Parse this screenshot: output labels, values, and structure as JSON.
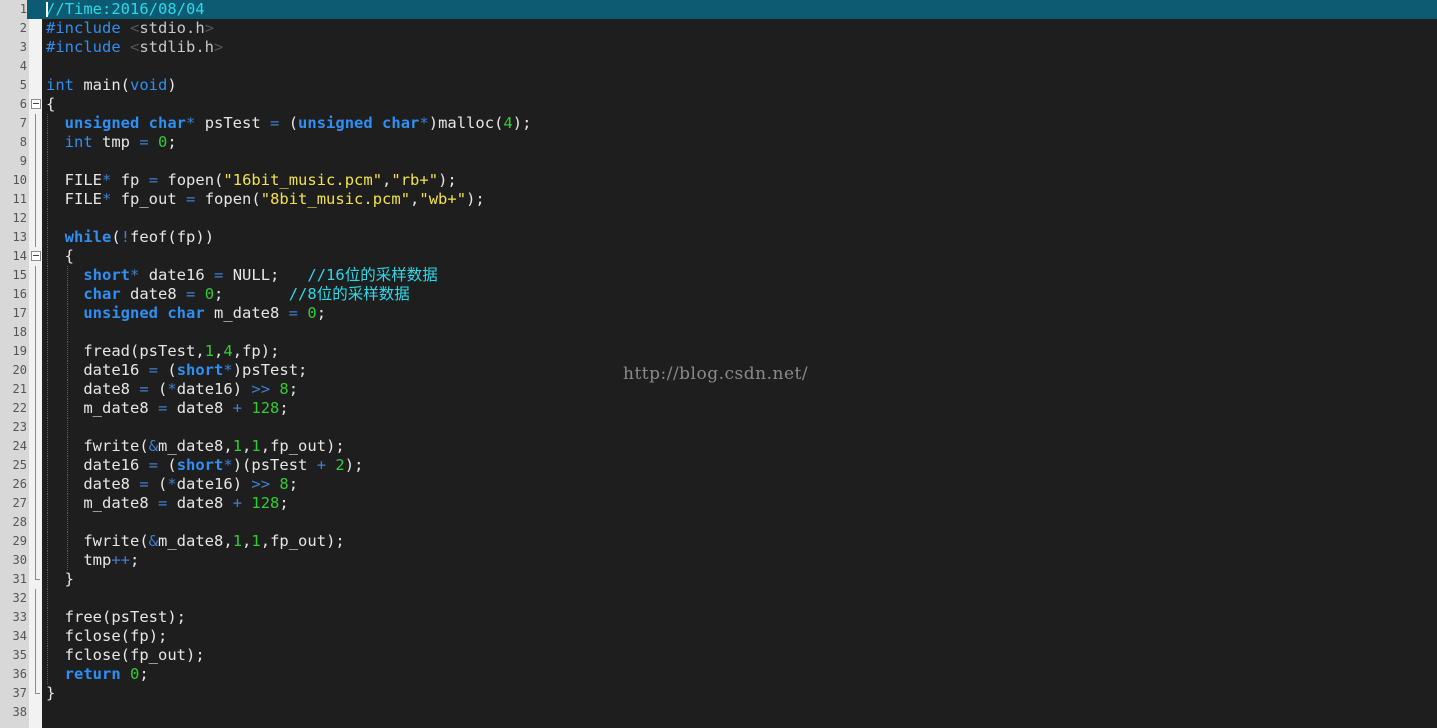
{
  "editor": {
    "language": "c",
    "current_line": 1,
    "colors": {
      "background": "#1e1e1e",
      "gutter": "#d8d8d8",
      "current_line": "#0d5a73",
      "keyword": "#2f8ff2",
      "number": "#33cc33",
      "string": "#f2e24a",
      "comment": "#2fd8e8"
    },
    "fold_icons": [
      "fold-minus-icon",
      "fold-line",
      "fold-end"
    ],
    "lines": [
      {
        "n": "1",
        "text": "//Time:2016/08/04"
      },
      {
        "n": "2",
        "text": "#include <stdio.h>"
      },
      {
        "n": "3",
        "text": "#include <stdlib.h>"
      },
      {
        "n": "4",
        "text": ""
      },
      {
        "n": "5",
        "text": "int main(void)"
      },
      {
        "n": "6",
        "text": "{"
      },
      {
        "n": "7",
        "text": "  unsigned char* psTest = (unsigned char*)malloc(4);"
      },
      {
        "n": "8",
        "text": "  int tmp = 0;"
      },
      {
        "n": "9",
        "text": ""
      },
      {
        "n": "10",
        "text": "  FILE* fp = fopen(\"16bit_music.pcm\",\"rb+\");"
      },
      {
        "n": "11",
        "text": "  FILE* fp_out = fopen(\"8bit_music.pcm\",\"wb+\");"
      },
      {
        "n": "12",
        "text": ""
      },
      {
        "n": "13",
        "text": "  while(!feof(fp))"
      },
      {
        "n": "14",
        "text": "  {"
      },
      {
        "n": "15",
        "text": "    short* date16 = NULL;   //16位的采样数据"
      },
      {
        "n": "16",
        "text": "    char date8 = 0;       //8位的采样数据"
      },
      {
        "n": "17",
        "text": "    unsigned char m_date8 = 0;"
      },
      {
        "n": "18",
        "text": ""
      },
      {
        "n": "19",
        "text": "    fread(psTest,1,4,fp);"
      },
      {
        "n": "20",
        "text": "    date16 = (short*)psTest;"
      },
      {
        "n": "21",
        "text": "    date8 = (*date16) >> 8;"
      },
      {
        "n": "22",
        "text": "    m_date8 = date8 + 128;"
      },
      {
        "n": "23",
        "text": ""
      },
      {
        "n": "24",
        "text": "    fwrite(&m_date8,1,1,fp_out);"
      },
      {
        "n": "25",
        "text": "    date16 = (short*)(psTest + 2);"
      },
      {
        "n": "26",
        "text": "    date8 = (*date16) >> 8;"
      },
      {
        "n": "27",
        "text": "    m_date8 = date8 + 128;"
      },
      {
        "n": "28",
        "text": ""
      },
      {
        "n": "29",
        "text": "    fwrite(&m_date8,1,1,fp_out);"
      },
      {
        "n": "30",
        "text": "    tmp++;"
      },
      {
        "n": "31",
        "text": "  }"
      },
      {
        "n": "32",
        "text": ""
      },
      {
        "n": "33",
        "text": "  free(psTest);"
      },
      {
        "n": "34",
        "text": "  fclose(fp);"
      },
      {
        "n": "35",
        "text": "  fclose(fp_out);"
      },
      {
        "n": "36",
        "text": "  return 0;"
      },
      {
        "n": "37",
        "text": "}"
      },
      {
        "n": "38",
        "text": ""
      }
    ]
  },
  "watermark": "http://blog.csdn.net/"
}
